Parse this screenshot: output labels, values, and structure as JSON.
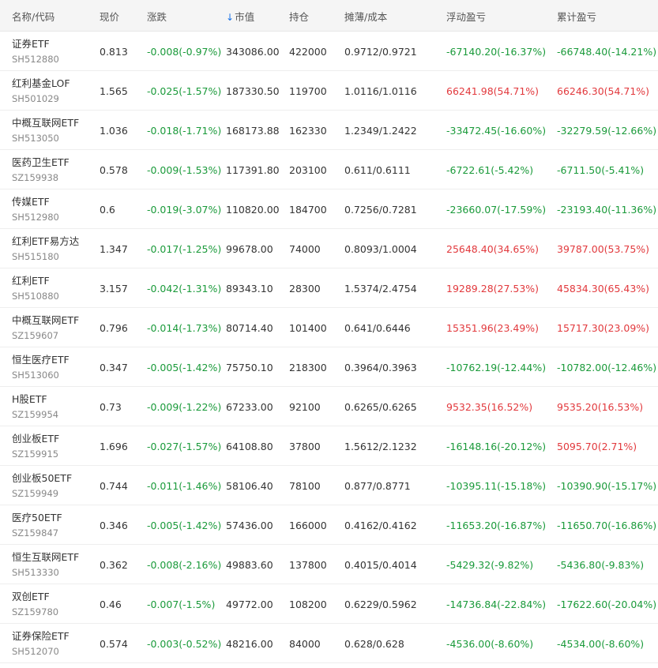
{
  "headers": {
    "name": "名称/代码",
    "price": "现价",
    "change": "涨跌",
    "sort_icon": "arrow-down-icon",
    "market_value": "市值",
    "holdings": "持仓",
    "cost": "摊薄/成本",
    "floating_pl": "浮动盈亏",
    "cumulative_pl": "累计盈亏"
  },
  "colors": {
    "gain": "#e2393d",
    "loss": "#1a9a3a",
    "sort_accent": "#1a73e8"
  },
  "rows": [
    {
      "name": "证券ETF",
      "code": "SH512880",
      "price": "0.813",
      "change": "-0.008(-0.97%)",
      "mv": "343086.00",
      "hold": "422000",
      "cost": "0.9712/0.9721",
      "float": "-67140.20(-16.37%)",
      "cum": "-66748.40(-14.21%)"
    },
    {
      "name": "红利基金LOF",
      "code": "SH501029",
      "price": "1.565",
      "change": "-0.025(-1.57%)",
      "mv": "187330.50",
      "hold": "119700",
      "cost": "1.0116/1.0116",
      "float": "66241.98(54.71%)",
      "cum": "66246.30(54.71%)"
    },
    {
      "name": "中概互联网ETF",
      "code": "SH513050",
      "price": "1.036",
      "change": "-0.018(-1.71%)",
      "mv": "168173.88",
      "hold": "162330",
      "cost": "1.2349/1.2422",
      "float": "-33472.45(-16.60%)",
      "cum": "-32279.59(-12.66%)"
    },
    {
      "name": "医药卫生ETF",
      "code": "SZ159938",
      "price": "0.578",
      "change": "-0.009(-1.53%)",
      "mv": "117391.80",
      "hold": "203100",
      "cost": "0.611/0.6111",
      "float": "-6722.61(-5.42%)",
      "cum": "-6711.50(-5.41%)"
    },
    {
      "name": "传媒ETF",
      "code": "SH512980",
      "price": "0.6",
      "change": "-0.019(-3.07%)",
      "mv": "110820.00",
      "hold": "184700",
      "cost": "0.7256/0.7281",
      "float": "-23660.07(-17.59%)",
      "cum": "-23193.40(-11.36%)"
    },
    {
      "name": "红利ETF易方达",
      "code": "SH515180",
      "price": "1.347",
      "change": "-0.017(-1.25%)",
      "mv": "99678.00",
      "hold": "74000",
      "cost": "0.8093/1.0004",
      "float": "25648.40(34.65%)",
      "cum": "39787.00(53.75%)"
    },
    {
      "name": "红利ETF",
      "code": "SH510880",
      "price": "3.157",
      "change": "-0.042(-1.31%)",
      "mv": "89343.10",
      "hold": "28300",
      "cost": "1.5374/2.4754",
      "float": "19289.28(27.53%)",
      "cum": "45834.30(65.43%)"
    },
    {
      "name": "中概互联网ETF",
      "code": "SZ159607",
      "price": "0.796",
      "change": "-0.014(-1.73%)",
      "mv": "80714.40",
      "hold": "101400",
      "cost": "0.641/0.6446",
      "float": "15351.96(23.49%)",
      "cum": "15717.30(23.09%)"
    },
    {
      "name": "恒生医疗ETF",
      "code": "SH513060",
      "price": "0.347",
      "change": "-0.005(-1.42%)",
      "mv": "75750.10",
      "hold": "218300",
      "cost": "0.3964/0.3963",
      "float": "-10762.19(-12.44%)",
      "cum": "-10782.00(-12.46%)"
    },
    {
      "name": "H股ETF",
      "code": "SZ159954",
      "price": "0.73",
      "change": "-0.009(-1.22%)",
      "mv": "67233.00",
      "hold": "92100",
      "cost": "0.6265/0.6265",
      "float": "9532.35(16.52%)",
      "cum": "9535.20(16.53%)"
    },
    {
      "name": "创业板ETF",
      "code": "SZ159915",
      "price": "1.696",
      "change": "-0.027(-1.57%)",
      "mv": "64108.80",
      "hold": "37800",
      "cost": "1.5612/2.1232",
      "float": "-16148.16(-20.12%)",
      "cum": "5095.70(2.71%)"
    },
    {
      "name": "创业板50ETF",
      "code": "SZ159949",
      "price": "0.744",
      "change": "-0.011(-1.46%)",
      "mv": "58106.40",
      "hold": "78100",
      "cost": "0.877/0.8771",
      "float": "-10395.11(-15.18%)",
      "cum": "-10390.90(-15.17%)"
    },
    {
      "name": "医疗50ETF",
      "code": "SZ159847",
      "price": "0.346",
      "change": "-0.005(-1.42%)",
      "mv": "57436.00",
      "hold": "166000",
      "cost": "0.4162/0.4162",
      "float": "-11653.20(-16.87%)",
      "cum": "-11650.70(-16.86%)"
    },
    {
      "name": "恒生互联网ETF",
      "code": "SH513330",
      "price": "0.362",
      "change": "-0.008(-2.16%)",
      "mv": "49883.60",
      "hold": "137800",
      "cost": "0.4015/0.4014",
      "float": "-5429.32(-9.82%)",
      "cum": "-5436.80(-9.83%)"
    },
    {
      "name": "双创ETF",
      "code": "SZ159780",
      "price": "0.46",
      "change": "-0.007(-1.5%)",
      "mv": "49772.00",
      "hold": "108200",
      "cost": "0.6229/0.5962",
      "float": "-14736.84(-22.84%)",
      "cum": "-17622.60(-20.04%)"
    },
    {
      "name": "证券保险ETF",
      "code": "SH512070",
      "price": "0.574",
      "change": "-0.003(-0.52%)",
      "mv": "48216.00",
      "hold": "84000",
      "cost": "0.628/0.628",
      "float": "-4536.00(-8.60%)",
      "cum": "-4534.00(-8.60%)"
    }
  ]
}
